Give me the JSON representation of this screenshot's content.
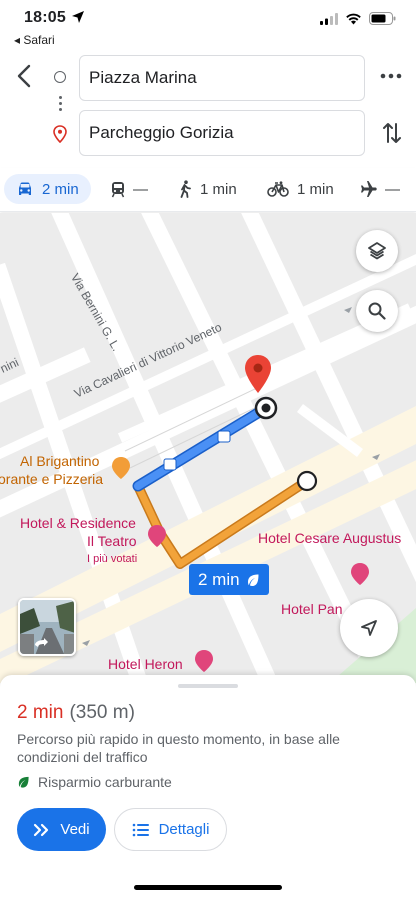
{
  "status_bar": {
    "time": "18:05",
    "back_app": "◂ Safari"
  },
  "route_inputs": {
    "origin": "Piazza Marina",
    "destination": "Parcheggio Gorizia"
  },
  "modes": [
    {
      "name": "car",
      "label": "2 min",
      "active": true
    },
    {
      "name": "transit",
      "label": "—"
    },
    {
      "name": "walk",
      "label": "1 min"
    },
    {
      "name": "bike",
      "label": "1 min"
    },
    {
      "name": "flight",
      "label": "—"
    }
  ],
  "map": {
    "streets": {
      "via_bernini": "Via Bernini G. L.",
      "via_cavalieri": "Via Cavalieri di Vittorio Veneto",
      "left_fragment": "nini"
    },
    "places": {
      "brigantino_line1": "Al Brigantino",
      "brigantino_line2": "orante e Pizzeria",
      "hotel_teatro_line1": "Hotel & Residence",
      "hotel_teatro_line2": "Il Teatro",
      "hotel_teatro_sub": "I più votati",
      "hotel_cesare": "Hotel Cesare Augustus",
      "hotel_pan": "Hotel Pan",
      "hotel_heron": "Hotel Heron"
    },
    "route_badge": "2 min",
    "colors": {
      "primary_route": "#4285f4",
      "alt_route": "#f29d38",
      "destination_pin": "#ea4335"
    }
  },
  "sheet": {
    "duration": "2 min",
    "distance": "(350 m)",
    "description": "Percorso più rapido in questo momento, in base alle condizioni del traffico",
    "eco_label": "Risparmio carburante",
    "start_button": "Vedi",
    "details_button": "Dettagli"
  }
}
